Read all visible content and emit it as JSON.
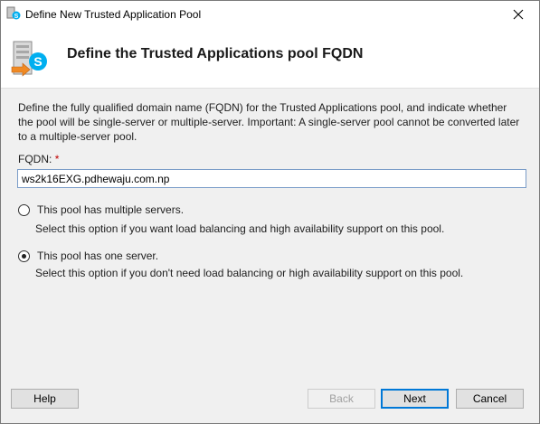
{
  "window": {
    "title": "Define New Trusted Application Pool"
  },
  "header": {
    "title": "Define the Trusted Applications pool FQDN"
  },
  "description": "Define the fully qualified domain name (FQDN) for the Trusted Applications pool, and indicate whether the pool will be single-server or multiple-server. Important: A single-server pool cannot be converted later to a multiple-server pool.",
  "fqdn": {
    "label": "FQDN:",
    "required_mark": "*",
    "value": "ws2k16EXG.pdhewaju.com.np"
  },
  "options": [
    {
      "label": "This pool has multiple servers.",
      "sub": "Select this option if you want load balancing and high availability support on this pool.",
      "checked": false
    },
    {
      "label": "This pool has one server.",
      "sub": "Select this option if you don't need load balancing or high availability support on this pool.",
      "checked": true
    }
  ],
  "buttons": {
    "help": "Help",
    "back": "Back",
    "next": "Next",
    "cancel": "Cancel"
  },
  "colors": {
    "accent": "#0078d7",
    "skype": "#00aff0",
    "required": "#c00000"
  }
}
